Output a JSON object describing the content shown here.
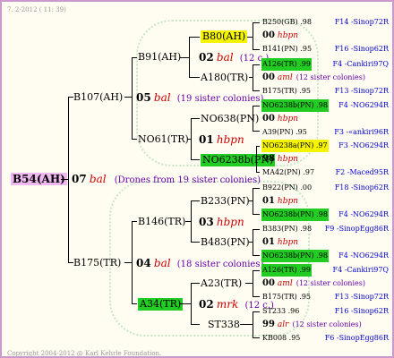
{
  "header": {
    "date_line": "7.  2-2012 ( 11: 39)"
  },
  "root": {
    "label": "B54(AH)"
  },
  "gen1": {
    "num": "07",
    "race": "bal",
    "note": "(Drones from 19 sister colonies)"
  },
  "f": {
    "B107": "B107(AH)",
    "B175": "B175(TR)"
  },
  "g2": {
    "top": {
      "num": "05",
      "race": "bal",
      "note": "(19 sister colonies)"
    },
    "bottom": {
      "num": "04",
      "race": "bal",
      "note": "(18 sister colonies)"
    }
  },
  "s": {
    "B91": "B91(AH)",
    "NO61": "NO61(TR)",
    "B146": "B146(TR)",
    "A34": "A34(TR)"
  },
  "g3": {
    "a": {
      "num": "02",
      "race": "bal",
      "note": "(12 c.)"
    },
    "b": {
      "num": "01",
      "race": "hbpn"
    },
    "c": {
      "num": "03",
      "race": "hbpn"
    },
    "d": {
      "num": "02",
      "race": "mrk",
      "note": "(12 c.)"
    }
  },
  "t": {
    "B80": "B80(AH)",
    "A180": "A180(TR)",
    "NO638": "NO638(PN)",
    "NO6238b": "NO6238b(PN)",
    "B233": "B233(PN)",
    "B483": "B483(PN)",
    "A23": "A23(TR)",
    "ST338": "ST338"
  },
  "right": [
    {
      "label": "B250(GB) .98",
      "code": "F14 -Sinop72R",
      "hl": ""
    },
    {
      "num": "00",
      "race": "hbpn"
    },
    {
      "label": "B141(PN) .95",
      "code": "F16 -Sinop62R",
      "hl": ""
    },
    {
      "label": "A126(TR) .99",
      "code": "F4 -Cankiri97Q",
      "hl": "g"
    },
    {
      "num": "00",
      "race": "aml",
      "note": "(12 sister colonies)"
    },
    {
      "label": "B175(TR) .95",
      "code": "F13 -Sinop72R",
      "hl": ""
    },
    {
      "label": "NO6238b(PN) .98",
      "code": "F4 -NO6294R",
      "hl": "g"
    },
    {
      "num": "00",
      "race": "hbpn"
    },
    {
      "label": "A39(PN) .95",
      "code": "F3 -«ankiri96R",
      "hl": ""
    },
    {
      "label": "NO6238a(PN) .97",
      "code": "F3 -NO6294R",
      "hl": "y"
    },
    {
      "num": "98",
      "race": "hbpn"
    },
    {
      "label": "MA42(PN) .97",
      "code": "F2 -Maced95R",
      "hl": ""
    },
    {
      "label": "B922(PN) .00",
      "code": "F18 -Sinop62R",
      "hl": ""
    },
    {
      "num": "01",
      "race": "hbpn"
    },
    {
      "label": "NO6238b(PN) .98",
      "code": "F4 -NO6294R",
      "hl": "g"
    },
    {
      "label": "B383(PN) .98",
      "code": "F9 -SinopEgg86R",
      "hl": ""
    },
    {
      "num": "01",
      "race": "hbpn"
    },
    {
      "label": "NO6238b(PN) .98",
      "code": "F4 -NO6294R",
      "hl": "g"
    },
    {
      "label": "A126(TR) .99",
      "code": "F4 -Cankiri97Q",
      "hl": "g"
    },
    {
      "num": "00",
      "race": "aml",
      "note": "(12 sister colonies)"
    },
    {
      "label": "B175(TR) .95",
      "code": "F13 -Sinop72R",
      "hl": ""
    },
    {
      "label": "ST233 .96",
      "code": "F16 -Sinop62R",
      "hl": ""
    },
    {
      "num": "99",
      "race": "alr",
      "note": "(12 sister colonies)"
    },
    {
      "label": "KB008 .95",
      "code": "F6 -SinopEgg86R",
      "hl": ""
    }
  ],
  "footer": {
    "copyright": "Copyright 2004-2012 @ Karl Kehrle Foundation."
  }
}
